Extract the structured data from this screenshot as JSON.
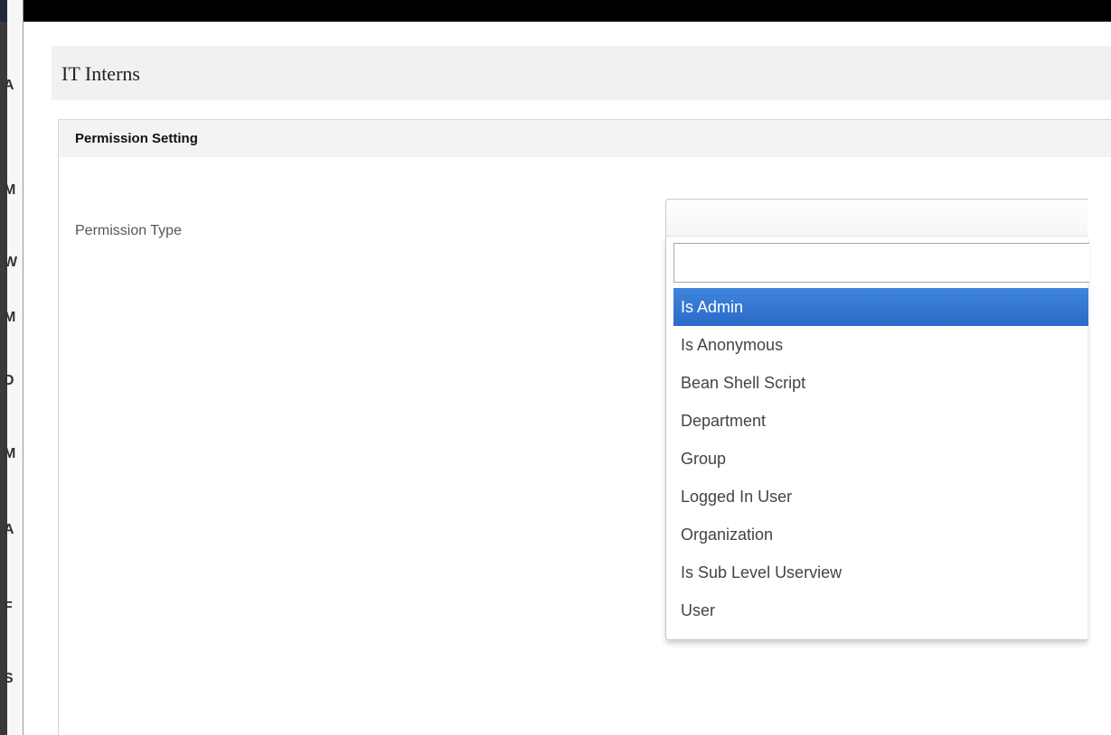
{
  "backdrop": {
    "letters": [
      "A",
      "M",
      "W",
      "M",
      "D",
      "M",
      "A",
      "F",
      "S"
    ]
  },
  "dialog": {
    "title": "IT Interns",
    "panel": {
      "title": "Permission Setting",
      "field_label": "Permission Type",
      "select": {
        "selected_value": "",
        "search_value": "",
        "options": [
          "Is Admin",
          "Is Anonymous",
          "Bean Shell Script",
          "Department",
          "Group",
          "Logged In User",
          "Organization",
          "Is Sub Level Userview",
          "User"
        ],
        "highlighted_option": "Is Admin"
      }
    }
  },
  "colors": {
    "highlight": "#2a6ac8",
    "header_bg": "#f1f1f1",
    "panel_heading_bg": "#f3f3f3"
  }
}
